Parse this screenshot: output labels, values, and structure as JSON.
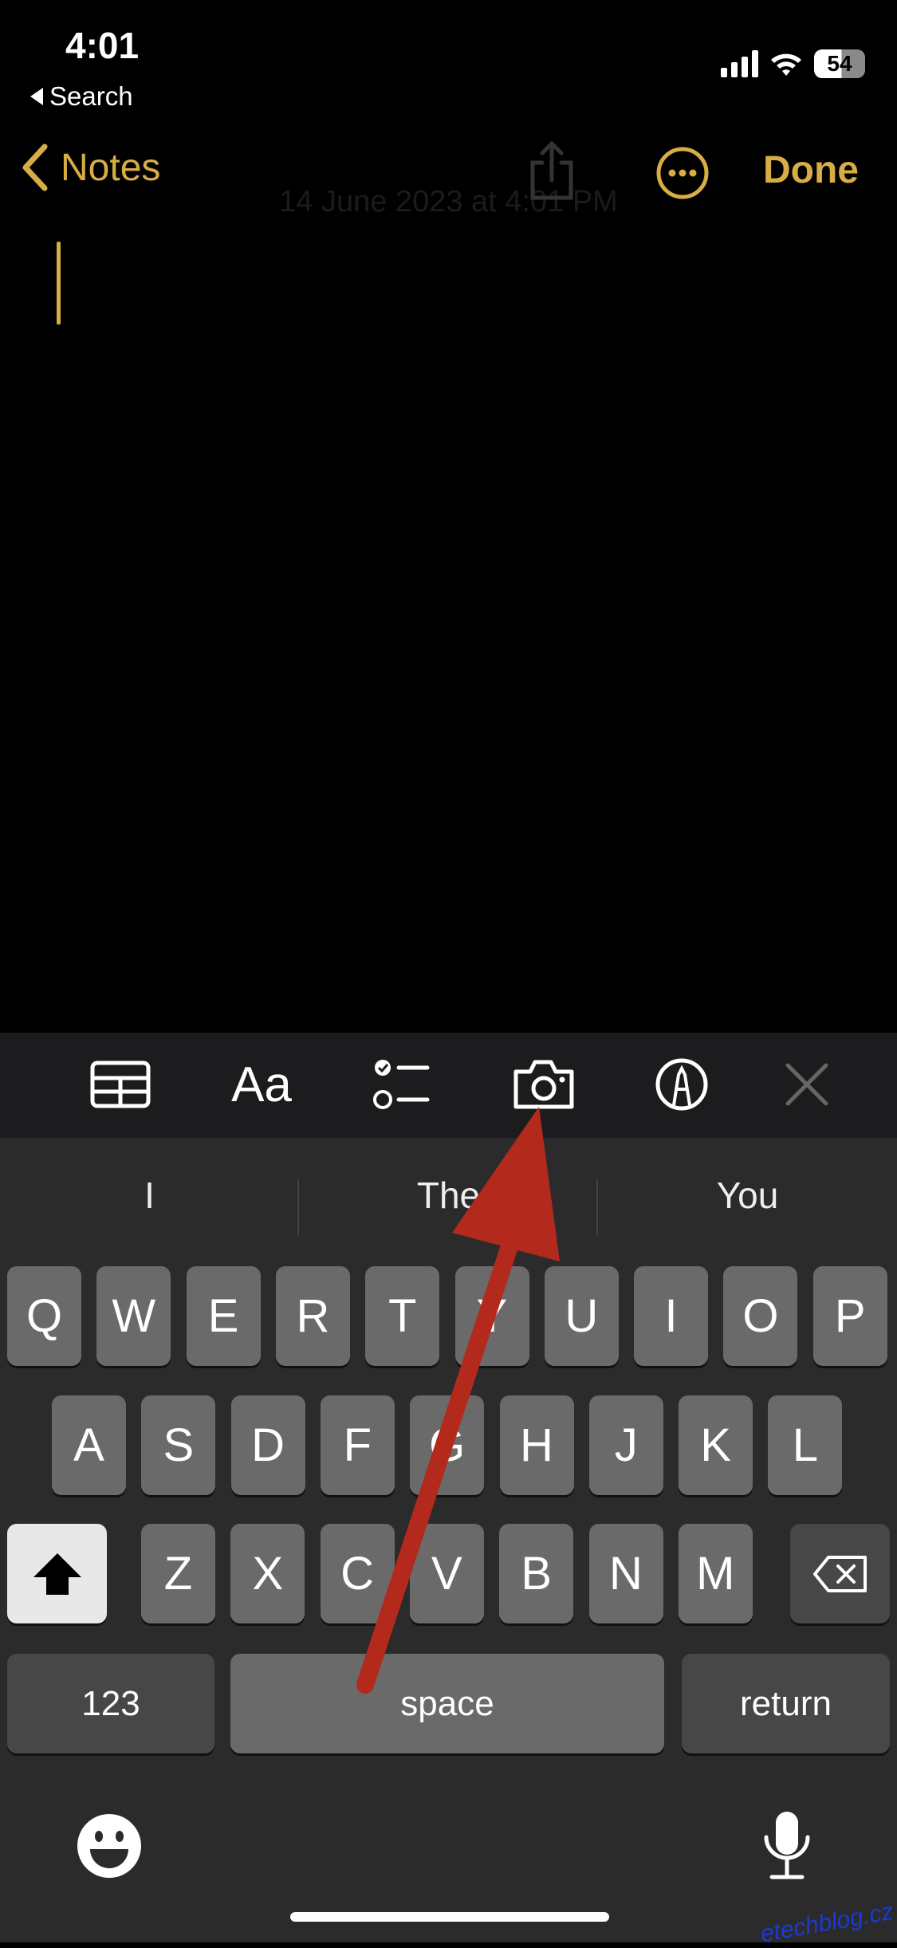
{
  "status": {
    "time": "4:01",
    "back_app": "Search",
    "battery": "54"
  },
  "nav": {
    "back": "Notes",
    "done": "Done"
  },
  "note": {
    "date": "14 June 2023 at 4:01 PM"
  },
  "toolbar": {
    "items": [
      "table-icon",
      "format-icon",
      "checklist-icon",
      "camera-icon",
      "markup-icon",
      "close-icon"
    ],
    "format_label": "Aa"
  },
  "suggestions": [
    "I",
    "The",
    "You"
  ],
  "keys": {
    "row1": [
      "Q",
      "W",
      "E",
      "R",
      "T",
      "Y",
      "U",
      "I",
      "O",
      "P"
    ],
    "row2": [
      "A",
      "S",
      "D",
      "F",
      "G",
      "H",
      "J",
      "K",
      "L"
    ],
    "row3": [
      "Z",
      "X",
      "C",
      "V",
      "B",
      "N",
      "M"
    ],
    "numbers": "123",
    "space": "space",
    "return": "return"
  },
  "colors": {
    "accent": "#d7ae45",
    "annotation_arrow": "#b3291b"
  },
  "watermark": "etechblog.cz"
}
